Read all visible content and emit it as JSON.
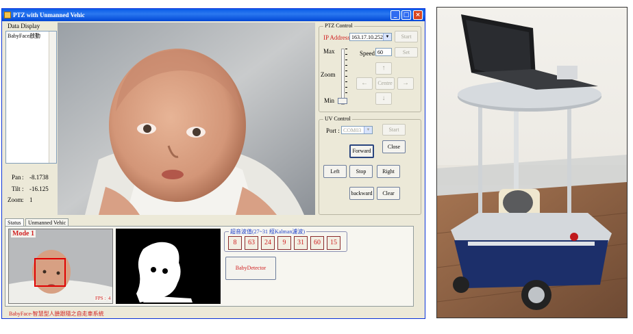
{
  "window": {
    "title": "PTZ with Unmanned Vehic",
    "controls": [
      "_",
      "□",
      "×"
    ]
  },
  "data_display": {
    "label": "Data Display",
    "log_lines": [
      "BabyFace啟動"
    ]
  },
  "readouts": [
    {
      "label": "Pan",
      "value": "-8.1738"
    },
    {
      "label": "Tilt",
      "value": "-16.125"
    },
    {
      "label": "Zoom",
      "value": "1"
    }
  ],
  "ptz": {
    "title": "PTZ Control",
    "ip_label": "IP Address :",
    "ip_value": "163.17.10.252",
    "start": "Start",
    "speed_label": "Speed",
    "speed_value": "60",
    "set": "Set",
    "zoom_max": "Max",
    "zoom_label": "Zoom",
    "zoom_min": "Min",
    "up": "↑",
    "left": "←",
    "centre": "Centre",
    "right": "→",
    "down": "↓"
  },
  "uv": {
    "title": "UV Control",
    "port_label": "Port :",
    "port_value": "COM03",
    "start": "Start",
    "close": "Close",
    "forward": "Forward",
    "left": "Left",
    "stop": "Stop",
    "right": "Right",
    "backward": "backward",
    "clear": "Clear"
  },
  "tabs": [
    "Status",
    "Unmanned Vehic"
  ],
  "status": {
    "mode": "Mode 1",
    "fps_label": "FPS :",
    "fps_value": "4"
  },
  "sonar": {
    "title": "超音波值(27~31 經Kalman濾波)",
    "values": [
      "8",
      "63",
      "24",
      "9",
      "31",
      "60",
      "15"
    ]
  },
  "detector_button": "BabyDetector",
  "footer": "BabyFace-智慧型人臉跟隨之自走車系統",
  "colors": {
    "title_bar": "#0a5ce8",
    "accent_red": "#d02020",
    "group_blue": "#1c3fc7",
    "window_bg": "#ece9d8"
  }
}
